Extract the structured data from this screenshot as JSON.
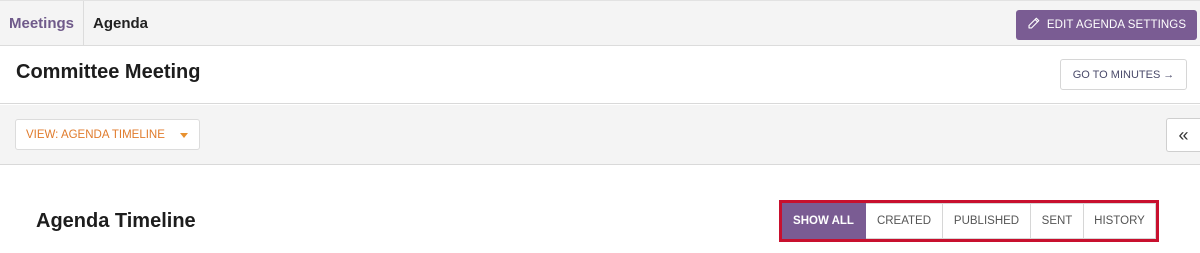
{
  "topbar": {
    "breadcrumb_parent": "Meetings",
    "breadcrumb_current": "Agenda",
    "edit_button_label": "EDIT AGENDA SETTINGS",
    "edit_button_icon": "pencil-icon"
  },
  "meeting": {
    "title": "Committee Meeting",
    "minutes_button_label": "GO TO MINUTES",
    "minutes_button_arrow": "→"
  },
  "toolbar": {
    "view_select_label": "VIEW: AGENDA TIMELINE",
    "collapse_glyph": "«"
  },
  "section": {
    "title": "Agenda Timeline"
  },
  "filters": [
    {
      "label": "SHOW ALL",
      "active": true
    },
    {
      "label": "CREATED",
      "active": false
    },
    {
      "label": "PUBLISHED",
      "active": false
    },
    {
      "label": "SENT",
      "active": false
    },
    {
      "label": "HISTORY",
      "active": false
    }
  ],
  "colors": {
    "accent_purple": "#7a5c93",
    "accent_orange": "#e07b2c",
    "highlight_red": "#c8102e"
  }
}
